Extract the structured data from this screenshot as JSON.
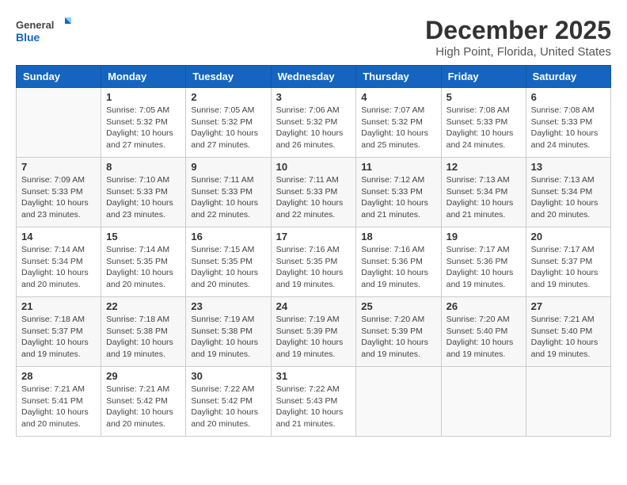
{
  "logo": {
    "general": "General",
    "blue": "Blue"
  },
  "title": "December 2025",
  "location": "High Point, Florida, United States",
  "days_of_week": [
    "Sunday",
    "Monday",
    "Tuesday",
    "Wednesday",
    "Thursday",
    "Friday",
    "Saturday"
  ],
  "weeks": [
    [
      {
        "day": "",
        "info": ""
      },
      {
        "day": "1",
        "info": "Sunrise: 7:05 AM\nSunset: 5:32 PM\nDaylight: 10 hours and 27 minutes."
      },
      {
        "day": "2",
        "info": "Sunrise: 7:05 AM\nSunset: 5:32 PM\nDaylight: 10 hours and 27 minutes."
      },
      {
        "day": "3",
        "info": "Sunrise: 7:06 AM\nSunset: 5:32 PM\nDaylight: 10 hours and 26 minutes."
      },
      {
        "day": "4",
        "info": "Sunrise: 7:07 AM\nSunset: 5:32 PM\nDaylight: 10 hours and 25 minutes."
      },
      {
        "day": "5",
        "info": "Sunrise: 7:08 AM\nSunset: 5:33 PM\nDaylight: 10 hours and 24 minutes."
      },
      {
        "day": "6",
        "info": "Sunrise: 7:08 AM\nSunset: 5:33 PM\nDaylight: 10 hours and 24 minutes."
      }
    ],
    [
      {
        "day": "7",
        "info": "Sunrise: 7:09 AM\nSunset: 5:33 PM\nDaylight: 10 hours and 23 minutes."
      },
      {
        "day": "8",
        "info": "Sunrise: 7:10 AM\nSunset: 5:33 PM\nDaylight: 10 hours and 23 minutes."
      },
      {
        "day": "9",
        "info": "Sunrise: 7:11 AM\nSunset: 5:33 PM\nDaylight: 10 hours and 22 minutes."
      },
      {
        "day": "10",
        "info": "Sunrise: 7:11 AM\nSunset: 5:33 PM\nDaylight: 10 hours and 22 minutes."
      },
      {
        "day": "11",
        "info": "Sunrise: 7:12 AM\nSunset: 5:33 PM\nDaylight: 10 hours and 21 minutes."
      },
      {
        "day": "12",
        "info": "Sunrise: 7:13 AM\nSunset: 5:34 PM\nDaylight: 10 hours and 21 minutes."
      },
      {
        "day": "13",
        "info": "Sunrise: 7:13 AM\nSunset: 5:34 PM\nDaylight: 10 hours and 20 minutes."
      }
    ],
    [
      {
        "day": "14",
        "info": "Sunrise: 7:14 AM\nSunset: 5:34 PM\nDaylight: 10 hours and 20 minutes."
      },
      {
        "day": "15",
        "info": "Sunrise: 7:14 AM\nSunset: 5:35 PM\nDaylight: 10 hours and 20 minutes."
      },
      {
        "day": "16",
        "info": "Sunrise: 7:15 AM\nSunset: 5:35 PM\nDaylight: 10 hours and 20 minutes."
      },
      {
        "day": "17",
        "info": "Sunrise: 7:16 AM\nSunset: 5:35 PM\nDaylight: 10 hours and 19 minutes."
      },
      {
        "day": "18",
        "info": "Sunrise: 7:16 AM\nSunset: 5:36 PM\nDaylight: 10 hours and 19 minutes."
      },
      {
        "day": "19",
        "info": "Sunrise: 7:17 AM\nSunset: 5:36 PM\nDaylight: 10 hours and 19 minutes."
      },
      {
        "day": "20",
        "info": "Sunrise: 7:17 AM\nSunset: 5:37 PM\nDaylight: 10 hours and 19 minutes."
      }
    ],
    [
      {
        "day": "21",
        "info": "Sunrise: 7:18 AM\nSunset: 5:37 PM\nDaylight: 10 hours and 19 minutes."
      },
      {
        "day": "22",
        "info": "Sunrise: 7:18 AM\nSunset: 5:38 PM\nDaylight: 10 hours and 19 minutes."
      },
      {
        "day": "23",
        "info": "Sunrise: 7:19 AM\nSunset: 5:38 PM\nDaylight: 10 hours and 19 minutes."
      },
      {
        "day": "24",
        "info": "Sunrise: 7:19 AM\nSunset: 5:39 PM\nDaylight: 10 hours and 19 minutes."
      },
      {
        "day": "25",
        "info": "Sunrise: 7:20 AM\nSunset: 5:39 PM\nDaylight: 10 hours and 19 minutes."
      },
      {
        "day": "26",
        "info": "Sunrise: 7:20 AM\nSunset: 5:40 PM\nDaylight: 10 hours and 19 minutes."
      },
      {
        "day": "27",
        "info": "Sunrise: 7:21 AM\nSunset: 5:40 PM\nDaylight: 10 hours and 19 minutes."
      }
    ],
    [
      {
        "day": "28",
        "info": "Sunrise: 7:21 AM\nSunset: 5:41 PM\nDaylight: 10 hours and 20 minutes."
      },
      {
        "day": "29",
        "info": "Sunrise: 7:21 AM\nSunset: 5:42 PM\nDaylight: 10 hours and 20 minutes."
      },
      {
        "day": "30",
        "info": "Sunrise: 7:22 AM\nSunset: 5:42 PM\nDaylight: 10 hours and 20 minutes."
      },
      {
        "day": "31",
        "info": "Sunrise: 7:22 AM\nSunset: 5:43 PM\nDaylight: 10 hours and 21 minutes."
      },
      {
        "day": "",
        "info": ""
      },
      {
        "day": "",
        "info": ""
      },
      {
        "day": "",
        "info": ""
      }
    ]
  ]
}
